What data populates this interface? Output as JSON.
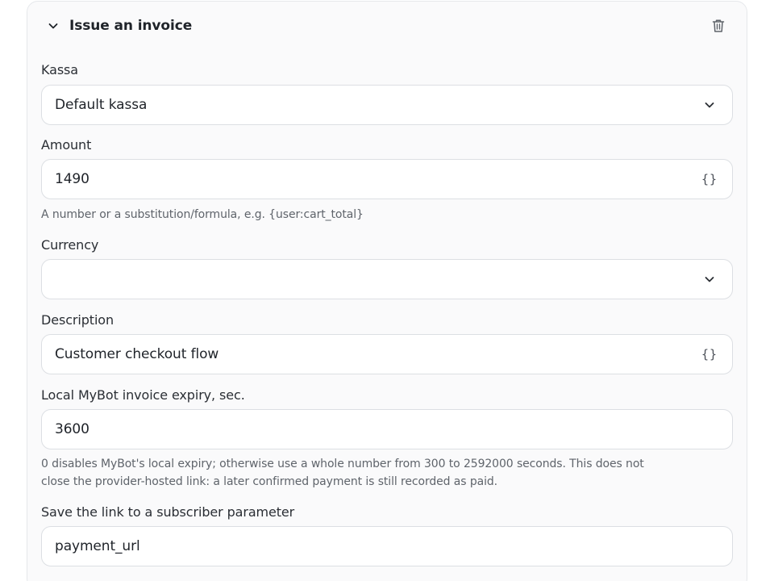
{
  "card": {
    "title": "Issue an invoice"
  },
  "fields": {
    "kassa": {
      "label": "Kassa",
      "value": "Default kassa"
    },
    "amount": {
      "label": "Amount",
      "value": "1490",
      "hint": "A number or a substitution/formula, e.g. {user:cart_total}"
    },
    "currency": {
      "label": "Currency",
      "value": ""
    },
    "description": {
      "label": "Description",
      "value": "Customer checkout flow"
    },
    "expiry": {
      "label": "Local MyBot invoice expiry, sec.",
      "value": "3600",
      "hint_line1": "0 disables MyBot's local expiry; otherwise use a whole number from 300 to 2592000 seconds. This does not",
      "hint_line2": "close the provider-hosted link: a later confirmed payment is still recorded as paid."
    },
    "save_link": {
      "label": "Save the link to a subscriber parameter",
      "value": "payment_url"
    }
  },
  "icons": {
    "collapse": "chevron-down-icon",
    "delete": "trash-icon",
    "dropdown": "chevron-down-icon",
    "variables": "braces-icon"
  }
}
